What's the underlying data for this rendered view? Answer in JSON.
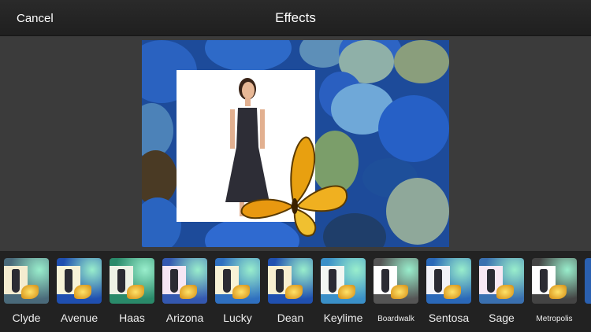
{
  "header": {
    "cancel_label": "Cancel",
    "title": "Effects"
  },
  "effects": [
    {
      "label": "Clyde",
      "bg": "#4a6a7a",
      "tint": "#f4ecd0"
    },
    {
      "label": "Avenue",
      "bg": "#1f4fb0",
      "tint": "#f7f3d8"
    },
    {
      "label": "Haas",
      "bg": "#2a8a6a",
      "tint": "#eef2e6"
    },
    {
      "label": "Arizona",
      "bg": "#3458b0",
      "tint": "#f6e6f4"
    },
    {
      "label": "Lucky",
      "bg": "#2f70c0",
      "tint": "#f7f2d6"
    },
    {
      "label": "Dean",
      "bg": "#2050b0",
      "tint": "#f7eed0"
    },
    {
      "label": "Keylime",
      "bg": "#3a90c8",
      "tint": "#f2f6f2"
    },
    {
      "label": "Boardwalk",
      "bg": "#555555",
      "tint": "#ffffff"
    },
    {
      "label": "Sentosa",
      "bg": "#2a68b8",
      "tint": "#f2f2f8"
    },
    {
      "label": "Sage",
      "bg": "#3a70b0",
      "tint": "#f8e8f4"
    },
    {
      "label": "Metropolis",
      "bg": "#444444",
      "tint": "#ffffff"
    }
  ]
}
